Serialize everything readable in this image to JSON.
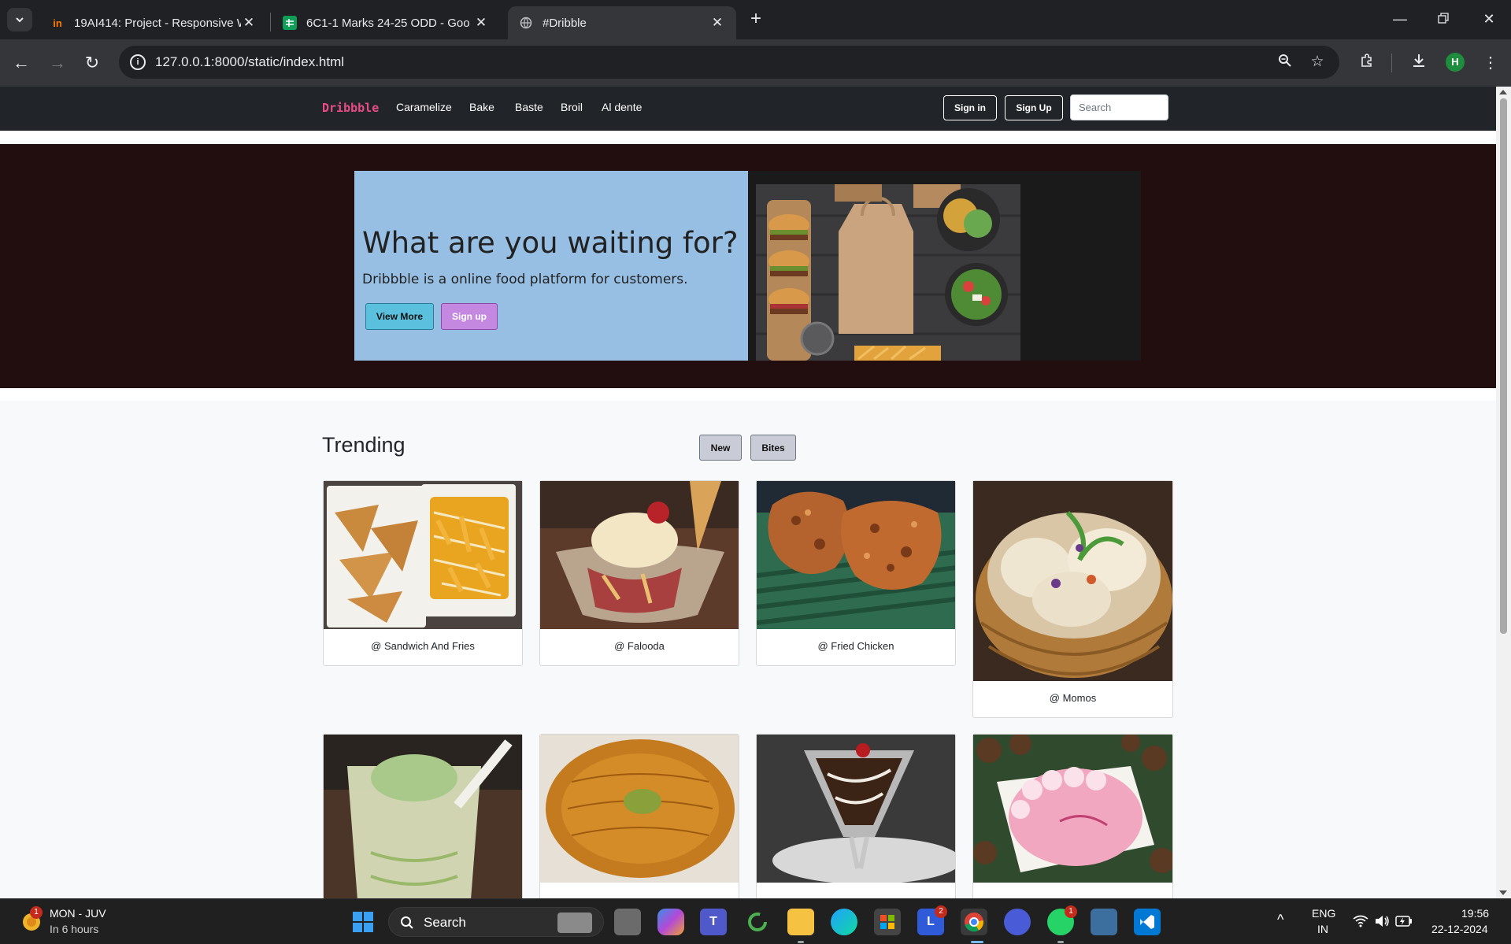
{
  "browser": {
    "tabs": [
      {
        "title": "19AI414: Project - Responsive W",
        "active": false
      },
      {
        "title": "6C1-1 Marks 24-25 ODD - Goo",
        "active": false
      },
      {
        "title": "#Dribble",
        "active": true
      }
    ],
    "url": "127.0.0.1:8000/static/index.html",
    "profile_initial": "H"
  },
  "site": {
    "brand": "Dribbble",
    "nav_links": [
      "Caramelize",
      "Bake",
      "Baste",
      "Broil",
      "Al dente"
    ],
    "sign_in": "Sign in",
    "sign_up": "Sign Up",
    "search_placeholder": "Search"
  },
  "hero": {
    "title": "What are you waiting for?",
    "text": "Dribbble is a online food platform for customers.",
    "view_more": "View More",
    "sign_up": "Sign up"
  },
  "trending": {
    "title": "Trending",
    "filters": [
      "New",
      "Bites"
    ],
    "cards": [
      {
        "caption": "@ Sandwich And Fries"
      },
      {
        "caption": "@ Falooda"
      },
      {
        "caption": "@ Fried Chicken"
      },
      {
        "caption": "@ Momos"
      },
      {
        "caption": ""
      },
      {
        "caption": ""
      },
      {
        "caption": ""
      },
      {
        "caption": ""
      }
    ]
  },
  "taskbar": {
    "weather_title": "MON - JUV",
    "weather_sub": "In 6 hours",
    "weather_badge": "1",
    "search_label": "Search",
    "lang_top": "ENG",
    "lang_bottom": "IN",
    "time": "19:56",
    "date": "22-12-2024",
    "badges": {
      "l_app": "2",
      "whatsapp": "1"
    }
  },
  "colors": {
    "brand": "#ea4c89",
    "nav_bg": "#212529",
    "hero_bg": "#220e0e",
    "hero_panel": "#97bfe3",
    "view_more_btn": "#5bc0de",
    "sign_up_btn": "#c488e0"
  }
}
